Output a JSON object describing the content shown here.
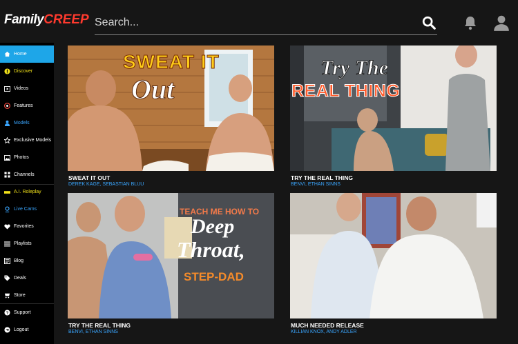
{
  "brand": {
    "part1": "Family",
    "part2": "CREEP"
  },
  "search": {
    "placeholder": "Search..."
  },
  "header_icons": [
    "search-icon",
    "bell-icon",
    "user-icon"
  ],
  "sidebar": {
    "items": [
      {
        "label": "Home",
        "icon": "home-icon",
        "active": true
      },
      {
        "label": "Discover",
        "icon": "discover-icon"
      },
      {
        "label": "Videos",
        "icon": "video-icon"
      },
      {
        "label": "Features",
        "icon": "features-icon"
      },
      {
        "label": "Models",
        "icon": "models-icon"
      },
      {
        "label": "Exclusive Models",
        "icon": "star-icon"
      },
      {
        "label": "Photos",
        "icon": "photo-icon"
      },
      {
        "label": "Channels",
        "icon": "channels-icon"
      },
      {
        "label": "A.I. Roleplay",
        "icon": "ai-icon"
      },
      {
        "label": "Live Cams",
        "icon": "livecam-icon"
      },
      {
        "label": "Favorites",
        "icon": "heart-icon"
      },
      {
        "label": "Playlists",
        "icon": "playlist-icon"
      },
      {
        "label": "Blog",
        "icon": "blog-icon"
      },
      {
        "label": "Deals",
        "icon": "tag-icon"
      },
      {
        "label": "Store",
        "icon": "store-icon"
      },
      {
        "label": "Support",
        "icon": "support-icon"
      },
      {
        "label": "Logout",
        "icon": "logout-icon"
      }
    ]
  },
  "videos": [
    {
      "title": "SWEAT IT OUT",
      "models": "DEREK KAGE, SEBASTIAN BLUU",
      "overlay_line1": "SWEAT IT",
      "overlay_line2": "Out"
    },
    {
      "title": "TRY THE REAL THING",
      "models": "BENVI, ETHAN SINNS",
      "overlay_line1": "Try The",
      "overlay_line2": "REAL THING"
    },
    {
      "title": "TRY THE REAL THING",
      "models": "BENVI, ETHAN SINNS",
      "overlay_line1": "TEACH ME HOW TO",
      "overlay_line2": "Deep",
      "overlay_line3": "Throat,",
      "overlay_line4": "STEP-DAD"
    },
    {
      "title": "MUCH NEEDED RELEASE",
      "models": "KILLIAN KNOX, ANDY ADLER"
    }
  ],
  "colors": {
    "accent": "#1ea6e8",
    "brand_red": "#ff3a2e",
    "link_blue": "#3aa6ff",
    "highlight_yellow": "#f2e21a"
  }
}
